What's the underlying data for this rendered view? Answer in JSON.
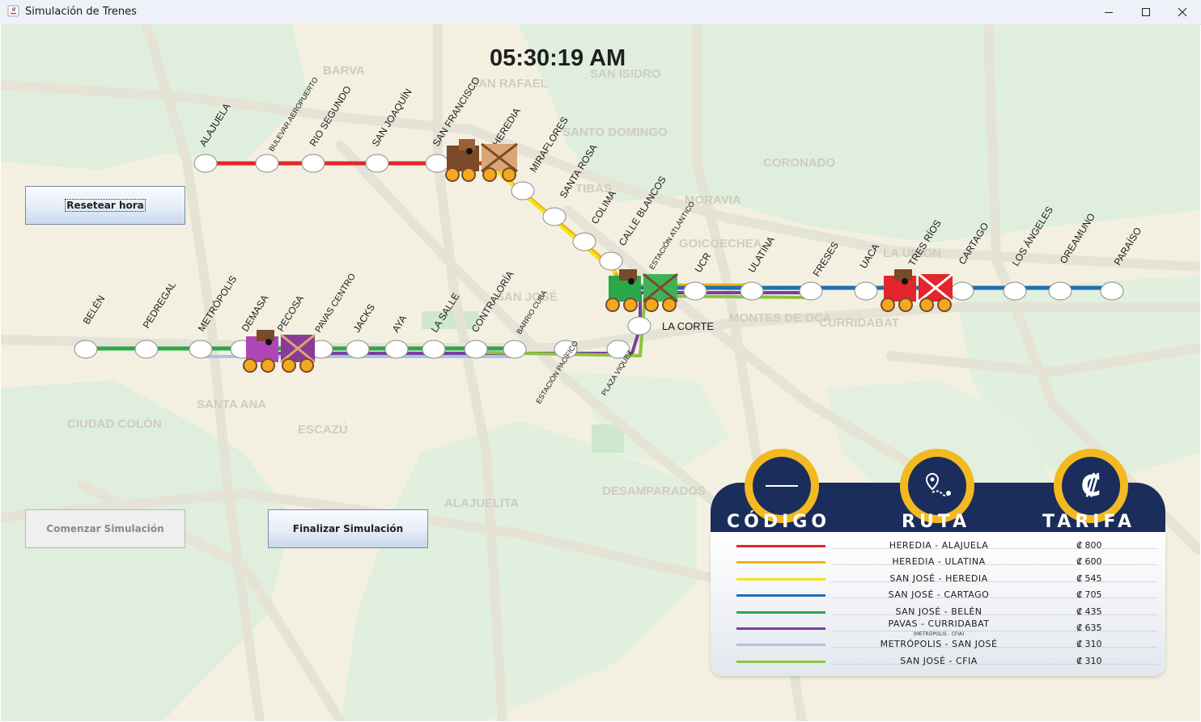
{
  "window": {
    "title": "Simulación de Trenes"
  },
  "clock": {
    "time": "05:30:19 AM"
  },
  "buttons": {
    "reset": "Resetear hora",
    "start": "Comenzar Simulación",
    "stop": "Finalizar Simulación"
  },
  "map_labels": [
    "BARVA",
    "SAN RAFAEL",
    "SAN ISIDRO",
    "SANTO DOMINGO",
    "TIBAS",
    "MORAVIA",
    "CORONADO",
    "GOICOECHEA",
    "LA UNION",
    "SAN JOSÉ",
    "MONTES DE OCA",
    "CURRIDABAT",
    "SANTA ANA",
    "CIUDAD COLÓN",
    "ESCAZÚ",
    "ALAJUELITA",
    "DESAMPARADOS"
  ],
  "stations": {
    "alajuela": "ALAJUELA",
    "bulevar": "BULEVAR AEROPUERTO",
    "rio_segundo": "RIO SEGUNDO",
    "san_joaquin": "SAN JOAQUÍN",
    "san_francisco": "SAN FRANCISCO",
    "heredia": "HEREDIA",
    "miraflores": "MIRAFLORES",
    "santa_rosa": "SANTA ROSA",
    "colima": "COLIMA",
    "calle_blancos": "CALLE BLANCOS",
    "estacion_atlantico": "ESTACIÓN ATLÁNTICO",
    "ucr": "UCR",
    "ulatina": "ULATINA",
    "freses": "FRESES",
    "uaca": "UACA",
    "tres_rios": "TRES RÍOS",
    "cartago": "CARTAGO",
    "los_angeles": "LOS ÁNGELES",
    "oreamuno": "OREAMUNO",
    "paraiso": "PARAÍSO",
    "la_corte": "LA CORTE",
    "belen": "BELÉN",
    "pedregal": "PEDREGAL",
    "metropolis": "METRÓPOLIS",
    "demasa": "DEMASA",
    "pecosa": "PECOSA",
    "pavas_centro": "PAVAS CENTRO",
    "jacks": "JACKS",
    "ava": "AYA",
    "la_salle": "LA SALLE",
    "contraloria": "CONTRALORÍA",
    "barrio_cuba": "BARRIO CUBA",
    "estacion_pacifico": "ESTACIÓN PACÍFICO",
    "plaza_viquez": "PLAZA VIQUEZ"
  },
  "legend": {
    "headers": {
      "code": "CÓDIGO",
      "route": "RUTA",
      "fare": "TARIFA"
    },
    "fare_symbol": "₡",
    "rows": [
      {
        "color": "#e2262b",
        "route": "HEREDIA - ALAJUELA",
        "sub": "",
        "fare": "₡ 800"
      },
      {
        "color": "#f2b311",
        "route": "HEREDIA - ULATINA",
        "sub": "",
        "fare": "₡ 600"
      },
      {
        "color": "#f2e31d",
        "route": "SAN JOSÉ - HEREDIA",
        "sub": "",
        "fare": "₡ 545"
      },
      {
        "color": "#1f6fb3",
        "route": "SAN JOSÉ - CARTAGO",
        "sub": "",
        "fare": "₡ 705"
      },
      {
        "color": "#2aa84a",
        "route": "SAN JOSÉ - BELÉN",
        "sub": "",
        "fare": "₡ 435"
      },
      {
        "color": "#7b3fa0",
        "route": "PAVAS - CURRIDABAT",
        "sub": "(METRÓPOLIS - CFIA)",
        "fare": "₡ 635"
      },
      {
        "color": "#a9c4e6",
        "route": "METRÓPOLIS - SAN JOSÉ",
        "sub": "",
        "fare": "₡ 310"
      },
      {
        "color": "#8bc43f",
        "route": "SAN JOSÉ - CFIA",
        "sub": "",
        "fare": "₡ 310"
      }
    ]
  },
  "colors": {
    "red_line": "#e2262b",
    "orange_line": "#f2b311",
    "yellow_line": "#f2e31d",
    "blue_line": "#1f6fb3",
    "green_line": "#2aa84a",
    "purple_line": "#7b3fa0",
    "lightblue_line": "#a9c4e6",
    "lime_line": "#8bc43f",
    "legend_navy": "#1b2d5b",
    "legend_gold": "#f3b920"
  }
}
